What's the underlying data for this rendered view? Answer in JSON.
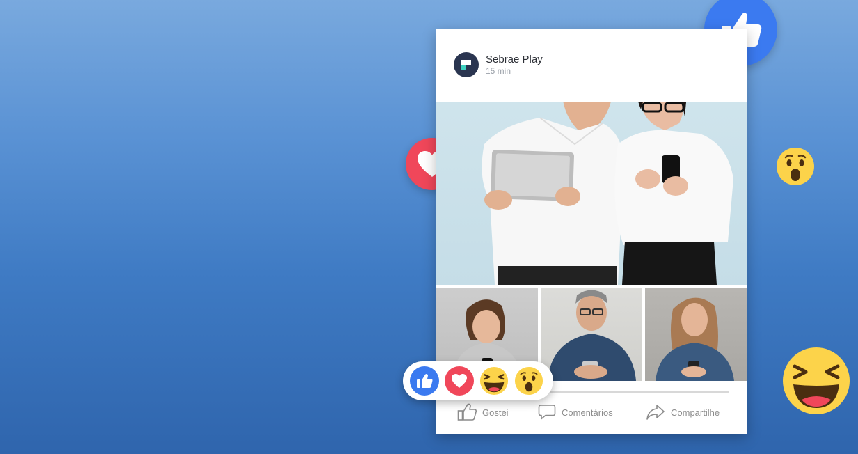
{
  "post": {
    "page_name": "Sebrae Play",
    "time_ago": "15 min"
  },
  "actions": {
    "like_label": "Gostei",
    "comments_label": "Comentários",
    "share_label": "Compartilhe"
  },
  "reactions": [
    "like-icon",
    "love-icon",
    "haha-icon",
    "wow-icon"
  ],
  "colors": {
    "like_blue": "#3b7af0",
    "love_red": "#f0475a",
    "emoji_yellow": "#fcd34a",
    "background_top": "#79a9de",
    "background_bottom": "#2f65ad"
  }
}
